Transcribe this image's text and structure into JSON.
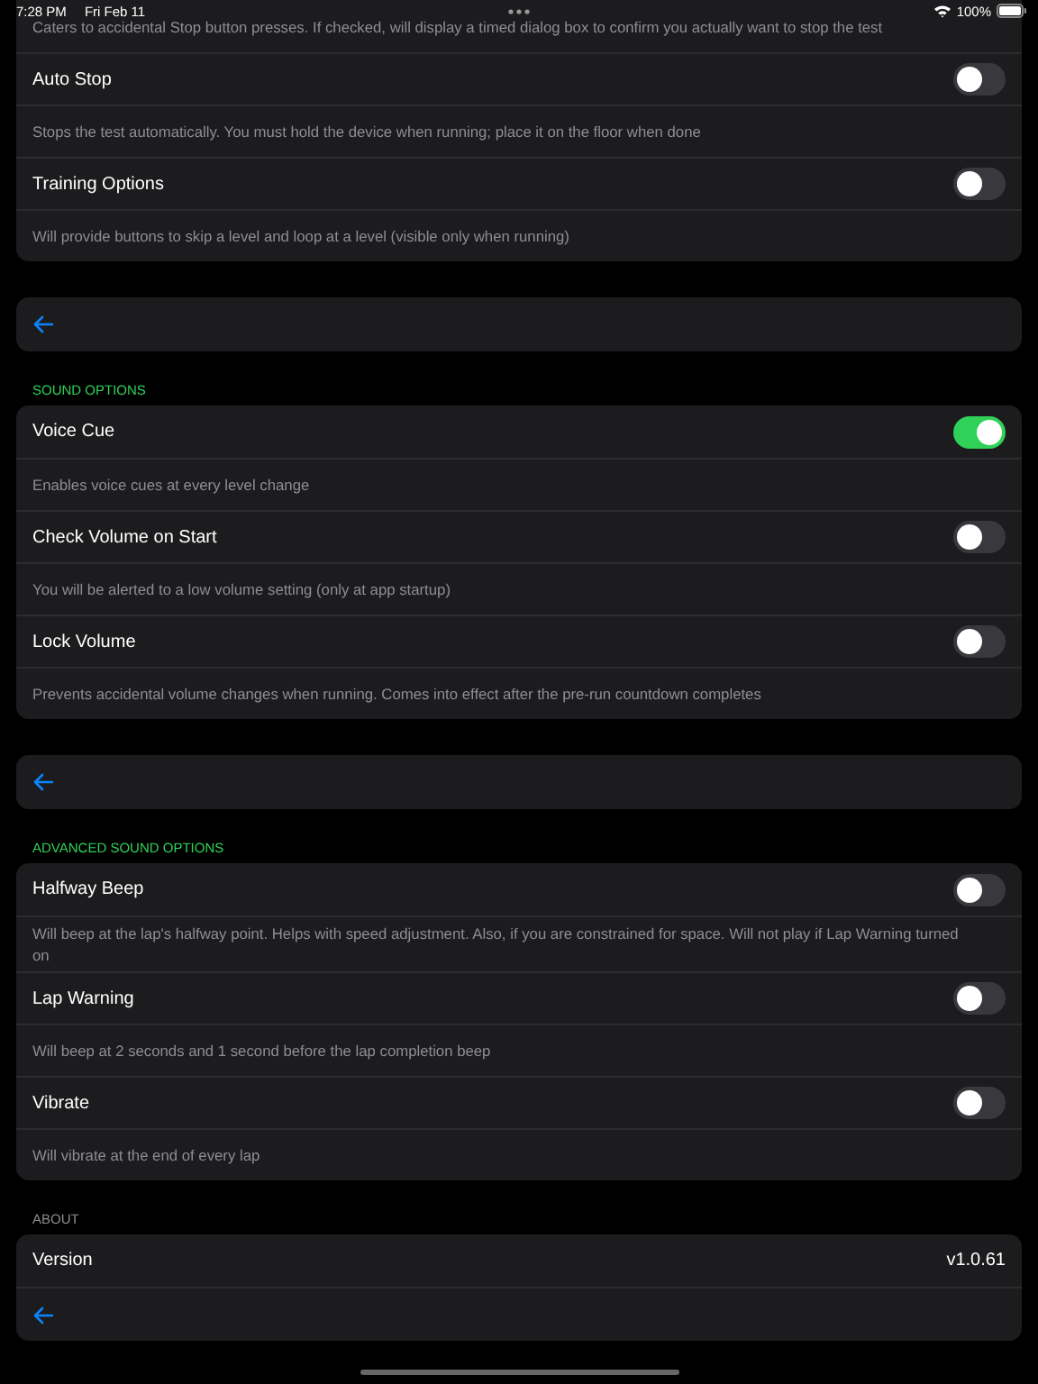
{
  "status_bar": {
    "time": "7:28 PM",
    "date": "Fri Feb 11",
    "battery": "100%"
  },
  "sections": [
    {
      "items": [
        {
          "kind": "note",
          "text": "Caters to accidental Stop button presses. If checked, will display a timed dialog box to confirm you actually want to stop the test"
        },
        {
          "kind": "toggle",
          "label": "Auto Stop",
          "on": false
        },
        {
          "kind": "note",
          "text": "Stops the test automatically. You must hold the device when running; place it on the floor when done"
        },
        {
          "kind": "toggle",
          "label": "Training Options",
          "on": false
        },
        {
          "kind": "note",
          "text": "Will provide buttons to skip a level and loop at a level (visible only when running)"
        }
      ]
    },
    {
      "items": [
        {
          "kind": "back"
        }
      ]
    },
    {
      "header": "SOUND OPTIONS",
      "color": "#30d158",
      "items": [
        {
          "kind": "toggle",
          "label": "Voice Cue",
          "on": true
        },
        {
          "kind": "note",
          "text": "Enables voice cues at every level change"
        },
        {
          "kind": "toggle",
          "label": "Check Volume on Start",
          "on": false
        },
        {
          "kind": "note",
          "text": "You will be alerted to a low volume setting (only at app startup)"
        },
        {
          "kind": "toggle",
          "label": "Lock Volume",
          "on": false
        },
        {
          "kind": "note",
          "text": "Prevents accidental volume changes when running. Comes into effect after the pre-run countdown completes"
        }
      ]
    },
    {
      "items": [
        {
          "kind": "back"
        }
      ]
    },
    {
      "header": "ADVANCED SOUND OPTIONS",
      "color": "#30d158",
      "items": [
        {
          "kind": "toggle",
          "label": "Halfway Beep",
          "on": false
        },
        {
          "kind": "note",
          "text": "Will beep at the lap's halfway point. Helps with speed adjustment. Also, if you are constrained for space. Will not play if Lap Warning turned on"
        },
        {
          "kind": "toggle",
          "label": "Lap Warning",
          "on": false
        },
        {
          "kind": "note",
          "text": "Will beep at 2 seconds and 1 second before the lap completion beep"
        },
        {
          "kind": "toggle",
          "label": "Vibrate",
          "on": false
        },
        {
          "kind": "note",
          "text": "Will vibrate at the end of every lap"
        }
      ]
    },
    {
      "header": "ABOUT",
      "color": "#8e8e93",
      "items": [
        {
          "kind": "value",
          "label": "Version",
          "value": "v1.0.61"
        },
        {
          "kind": "back"
        }
      ]
    }
  ]
}
